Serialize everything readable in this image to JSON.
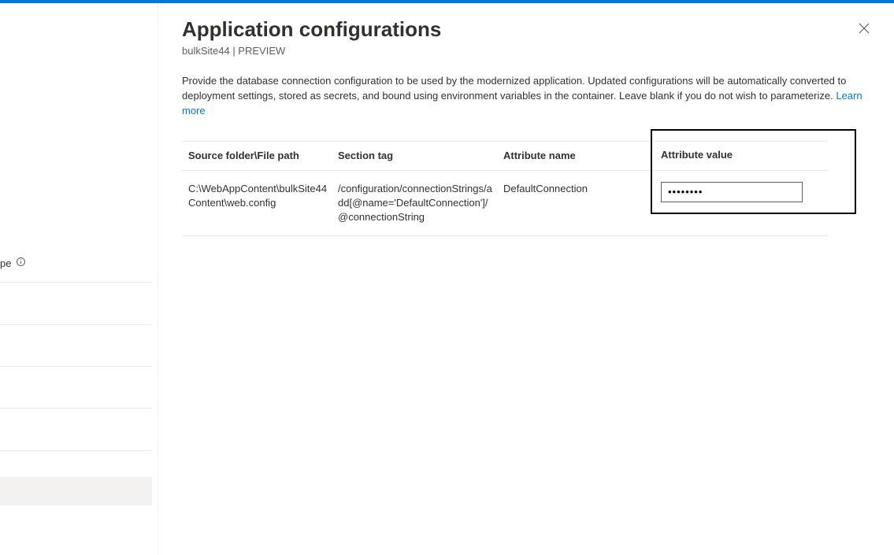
{
  "header": {
    "title": "Application configurations",
    "subtitle": "bulkSite44 | PREVIEW"
  },
  "description": {
    "text": "Provide the database connection configuration to be used by the modernized application. Updated configurations will be automatically converted to deployment settings, stored as secrets, and bound using environment variables in the container. Leave blank if you do not wish to parameterize. ",
    "learn_more": "Learn more"
  },
  "table": {
    "headers": {
      "source": "Source folder\\File path",
      "section": "Section tag",
      "attr_name": "Attribute name",
      "attr_value": "Attribute value"
    },
    "row": {
      "source": "C:\\WebAppContent\\bulkSite44Content\\web.config",
      "section": "/configuration/connectionStrings/add[@name='DefaultConnection']/@connectionString",
      "attr_name": "DefaultConnection",
      "attr_value": "••••••••"
    }
  },
  "left": {
    "fragment_text": "pe"
  }
}
